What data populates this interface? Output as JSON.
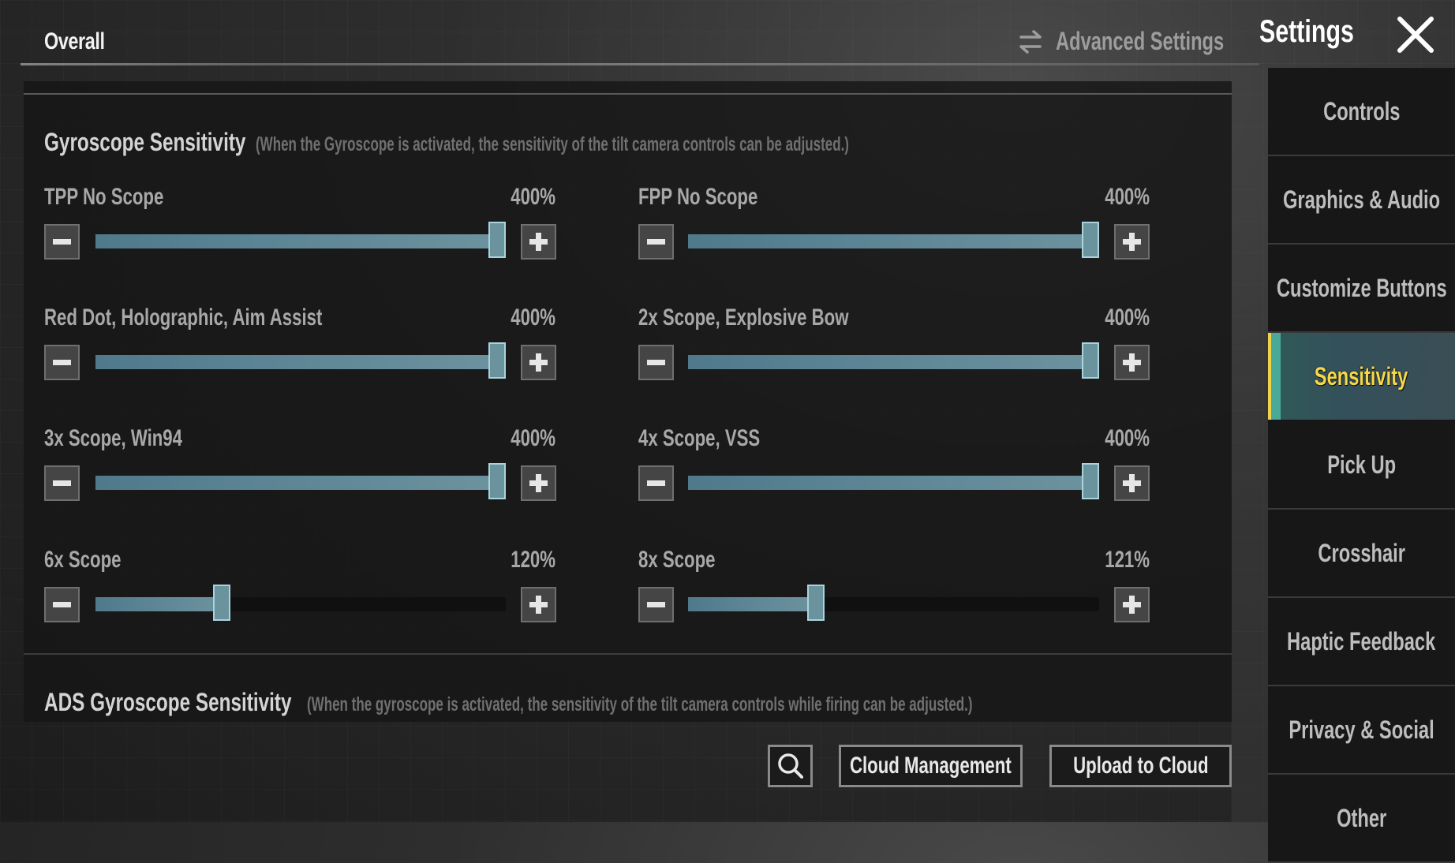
{
  "header": {
    "active_tab": "Overall",
    "advanced_settings_label": "Advanced Settings",
    "advanced_settings_icon": "swap-arrows-icon",
    "title": "Settings",
    "close_icon": "close-icon"
  },
  "gyro_section": {
    "title": "Gyroscope Sensitivity",
    "description": "(When the Gyroscope is activated, the sensitivity of the tilt camera controls can be adjusted.)",
    "slider_max_percent": 400,
    "sliders": [
      {
        "label": "TPP No Scope",
        "value": "400%",
        "percent": 400
      },
      {
        "label": "FPP No Scope",
        "value": "400%",
        "percent": 400
      },
      {
        "label": "Red Dot, Holographic, Aim Assist",
        "value": "400%",
        "percent": 400
      },
      {
        "label": "2x Scope, Explosive Bow",
        "value": "400%",
        "percent": 400
      },
      {
        "label": "3x Scope, Win94",
        "value": "400%",
        "percent": 400
      },
      {
        "label": "4x Scope, VSS",
        "value": "400%",
        "percent": 400
      },
      {
        "label": "6x Scope",
        "value": "120%",
        "percent": 120
      },
      {
        "label": "8x Scope",
        "value": "121%",
        "percent": 121
      }
    ]
  },
  "ads_section": {
    "title": "ADS Gyroscope Sensitivity",
    "description": "(When the gyroscope is activated, the sensitivity of the tilt camera controls while firing can be adjusted.)"
  },
  "footer": {
    "search_icon": "search-icon",
    "cloud_management_label": "Cloud Management",
    "upload_label": "Upload to Cloud"
  },
  "sidebar": {
    "active_index": 3,
    "items": [
      {
        "label": "Controls"
      },
      {
        "label": "Graphics & Audio"
      },
      {
        "label": "Customize Buttons"
      },
      {
        "label": "Sensitivity"
      },
      {
        "label": "Pick Up"
      },
      {
        "label": "Crosshair"
      },
      {
        "label": "Haptic Feedback"
      },
      {
        "label": "Privacy & Social"
      },
      {
        "label": "Other"
      }
    ]
  },
  "colors": {
    "accent_active_text": "#f5d84a",
    "slider_fill": "#5f8896",
    "slider_thumb_border": "#a9d4dc"
  }
}
